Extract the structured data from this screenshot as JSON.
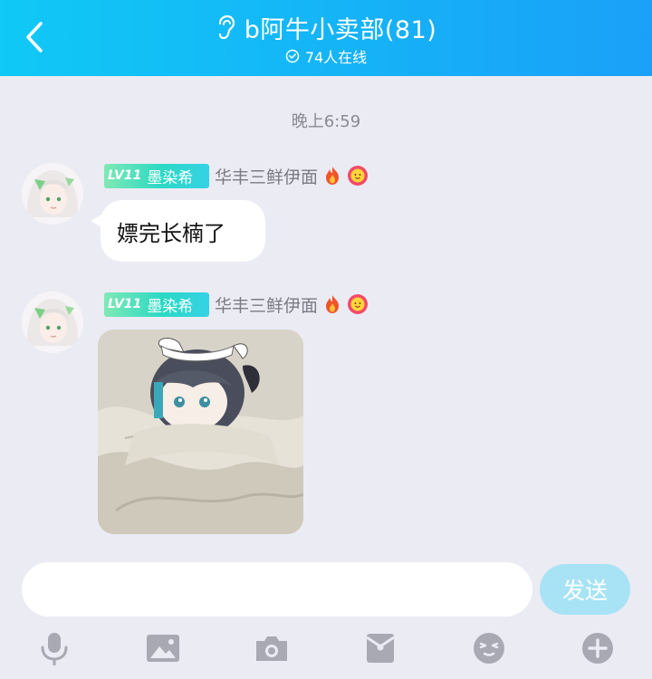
{
  "header": {
    "title": "b阿牛小卖部(81)",
    "online": "74人在线",
    "back_icon": "chevron-left-icon",
    "ear_icon": "ear-icon",
    "online_icon": "check-circle-icon"
  },
  "chat": {
    "timestamp": "晚上6:59",
    "messages": [
      {
        "level": "LV11",
        "badge_name": "墨染希",
        "sender": "华丰三鲜伊面",
        "text": "嫖完长楠了"
      },
      {
        "level": "LV11",
        "badge_name": "墨染希",
        "sender": "华丰三鲜伊面",
        "type": "image"
      }
    ]
  },
  "input": {
    "placeholder": "",
    "value": ""
  },
  "send_label": "发送",
  "toolbar": [
    "microphone-icon",
    "image-icon",
    "camera-icon",
    "red-packet-icon",
    "emoji-icon",
    "plus-icon"
  ],
  "colors": {
    "header_start": "#10c9f6",
    "header_end": "#1aa0f8",
    "background": "#ebebf4",
    "send_button": "#a8e3f5",
    "toolbar_icon": "#a9a9b4"
  }
}
